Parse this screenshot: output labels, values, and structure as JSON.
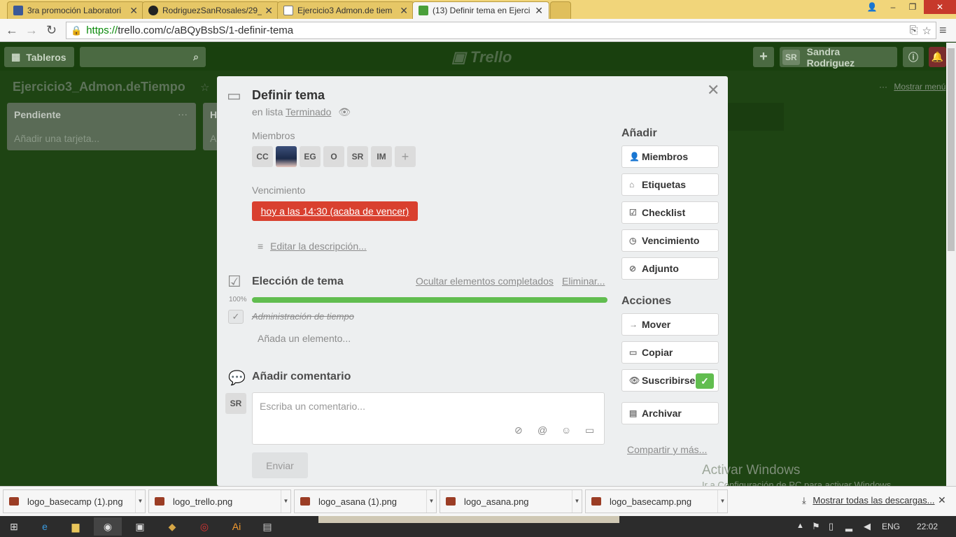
{
  "browser": {
    "tabs": [
      {
        "title": "3ra promoción Laboratori",
        "favicon_color": "#3b5998"
      },
      {
        "title": "RodriguezSanRosales/29_",
        "favicon_color": "#222222"
      },
      {
        "title": "Ejercicio3 Admon.de tiem",
        "favicon_color": "#777777"
      },
      {
        "title": "(13) Definir tema en Ejerci",
        "favicon_color": "#4a9f3a",
        "active": true
      }
    ],
    "url_https": "https://",
    "url_rest": "trello.com/c/aBQyBsbS/1-definir-tema"
  },
  "trello": {
    "boards_label": "Tableros",
    "logo": "Trello",
    "user_initials": "SR",
    "user_name": "Sandra Rodriguez",
    "board_title": "Ejercicio3_Admon.deTiempo",
    "show_menu": "Mostrar menú",
    "lists": [
      {
        "title": "Pendiente",
        "add_card": "Añadir una tarjeta..."
      },
      {
        "title": "H",
        "add_card": "A"
      }
    ]
  },
  "card": {
    "title": "Definir tema",
    "in_list_prefix": "en lista",
    "list_name": "Terminado",
    "members_label": "Miembros",
    "members": [
      "CC",
      "",
      "EG",
      "O",
      "SR",
      "IM"
    ],
    "add_member": "+",
    "due_label": "Vencimiento",
    "due_value": "hoy a las 14:30 (acaba de vencer)",
    "due_color": "#d9402f",
    "edit_description": "Editar la descripción...",
    "checklist": {
      "title": "Elección de tema",
      "hide_completed": "Ocultar elementos completados",
      "delete": "Eliminar...",
      "progress_text": "100%",
      "progress": 1.0,
      "progress_color": "#61bd4f",
      "items": [
        {
          "text": "Administración de tiempo",
          "done": true
        }
      ],
      "add_item": "Añada un elemento..."
    },
    "comment": {
      "title": "Añadir comentario",
      "avatar": "SR",
      "placeholder": "Escriba un comentario...",
      "send": "Enviar"
    },
    "sidebar": {
      "add_title": "Añadir",
      "add_buttons": [
        "Miembros",
        "Etiquetas",
        "Checklist",
        "Vencimiento",
        "Adjunto"
      ],
      "actions_title": "Acciones",
      "action_buttons": [
        "Mover",
        "Copiar",
        "Suscribirse"
      ],
      "archive": "Archivar",
      "share": "Compartir y más..."
    }
  },
  "downloads": {
    "items": [
      "logo_basecamp (1).png",
      "logo_trello.png",
      "logo_asana (1).png",
      "logo_asana.png",
      "logo_basecamp.png"
    ],
    "show_all": "Mostrar todas las descargas..."
  },
  "watermark": {
    "line1": "Activar Windows",
    "line2": "Ir a Configuración de PC para activar Windows."
  },
  "taskbar": {
    "lang": "ENG",
    "time": "22:02"
  }
}
